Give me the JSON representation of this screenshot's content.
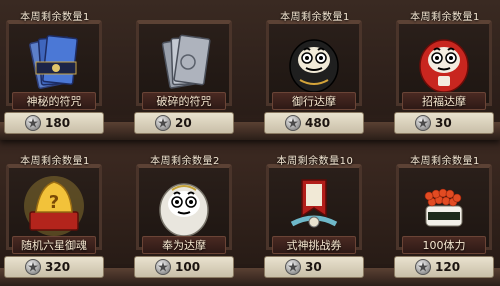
{
  "shop": {
    "items": [
      {
        "quota": "本周剩余数量1",
        "name": "神秘的符咒",
        "price": "180",
        "icon": "mystery-talisman-icon"
      },
      {
        "quota": "",
        "name": "破碎的符咒",
        "price": "20",
        "icon": "broken-talisman-icon"
      },
      {
        "quota": "本周剩余数量1",
        "name": "御行达摩",
        "price": "480",
        "icon": "black-daruma-icon"
      },
      {
        "quota": "本周剩余数量1",
        "name": "招福达摩",
        "price": "30",
        "icon": "red-daruma-icon"
      },
      {
        "quota": "本周剩余数量1",
        "name": "随机六星御魂",
        "price": "320",
        "icon": "golden-soul-icon"
      },
      {
        "quota": "本周剩余数量2",
        "name": "奉为达摩",
        "price": "100",
        "icon": "white-daruma-icon"
      },
      {
        "quota": "本周剩余数量10",
        "name": "式神挑战券",
        "price": "30",
        "icon": "challenge-ticket-icon"
      },
      {
        "quota": "本周剩余数量1",
        "name": "100体力",
        "price": "120",
        "icon": "sushi-stamina-icon"
      }
    ],
    "colors": {
      "background": "#2b1f1a",
      "frame": "#4a342a",
      "name_plate": "#3a2019",
      "price_plate": "#e3dbc7",
      "text_light": "#f3e6d2"
    }
  }
}
